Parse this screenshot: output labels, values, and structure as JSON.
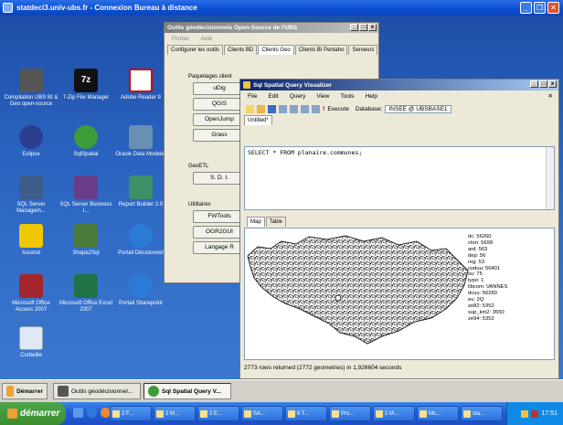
{
  "rdp": {
    "title": "statdeci3.univ-ubs.fr - Connexion Bureau à distance"
  },
  "desktop_icons": [
    {
      "label": "Compilation UBS BI & Geo open-source"
    },
    {
      "label": "7-Zip File Manager"
    },
    {
      "label": "Adobe Reader 9"
    },
    {
      "label": "Eclipse"
    },
    {
      "label": "SqlSpatial"
    },
    {
      "label": "Oracle Data Modeler"
    },
    {
      "label": "SQL Server Managem..."
    },
    {
      "label": "SQL Server Business I..."
    },
    {
      "label": "Report Builder 2.0"
    },
    {
      "label": "Ascend"
    },
    {
      "label": "Shape2Sql"
    },
    {
      "label": "Portail Décisionnel"
    },
    {
      "label": "Microsoft Office Access 2007"
    },
    {
      "label": "Microsoft Office Excel 2007"
    },
    {
      "label": "Portail Sharepoint"
    },
    {
      "label": "Corbeille"
    }
  ],
  "tools_window": {
    "title": "Outils géodécisionnels Open-Source de l'UBS",
    "menu": [
      "Fichier",
      "Aide"
    ],
    "tabs": [
      "Configurer les outils",
      "Clients BD",
      "Clients Geo",
      "Clients BI Pentaho",
      "Serveurs"
    ],
    "groups": [
      {
        "label": "Paquetages client",
        "buttons": [
          "uDig",
          "QGIS",
          "OpenJump",
          "Grass"
        ]
      },
      {
        "label": "GeoETL",
        "buttons": [
          "S. D. I."
        ]
      },
      {
        "label": "Utilitaires",
        "buttons": [
          "FWTools",
          "OGR2GUI",
          "Langage R"
        ]
      }
    ]
  },
  "sql_window": {
    "title": "Sql Spatial Query Visualizer",
    "menu": [
      "File",
      "Edit",
      "Query",
      "View",
      "Tools",
      "Help"
    ],
    "execute_label": "Execute",
    "database_label": "Database:",
    "database_value": "INSEE @ UBSBASE1",
    "doc_tab": "Untitled*",
    "query": "SELECT * FROM planaire.communes;",
    "result_tabs": [
      "Map",
      "Table"
    ],
    "status": "2773 rows returned (2772 geometries) in 1,926604 seconds",
    "tooltip": [
      "dc: 56260",
      "cton: 5699",
      "ard: 563",
      "dep: 56",
      "reg: 53",
      "coduu: 56401",
      "su: 75",
      "typo: 1",
      "libcom: VANNES",
      "dcuu: 56260",
      "eu: 2Q",
      "ze82: 5352",
      "sup_km2: 3550",
      "ze94: 5352"
    ]
  },
  "rdp_taskbar": {
    "start_label": "Démarrer",
    "buttons": [
      "Outils géodécisionnel...",
      "Sql Spatial Query V..."
    ]
  },
  "host_taskbar": {
    "start_label": "démarrer",
    "buttons": [
      "2 F...",
      "2 M...",
      "2 E...",
      "SA...",
      "6 T...",
      "Pro...",
      "2 M...",
      "Mc...",
      "sta..."
    ],
    "clock": "17:51"
  },
  "colors": {
    "xp_blue": "#0a4fd1",
    "map_land": "#ffffff",
    "map_border": "#222222",
    "map_bg": "#ffffff",
    "start_green": "#3c8d2f"
  }
}
